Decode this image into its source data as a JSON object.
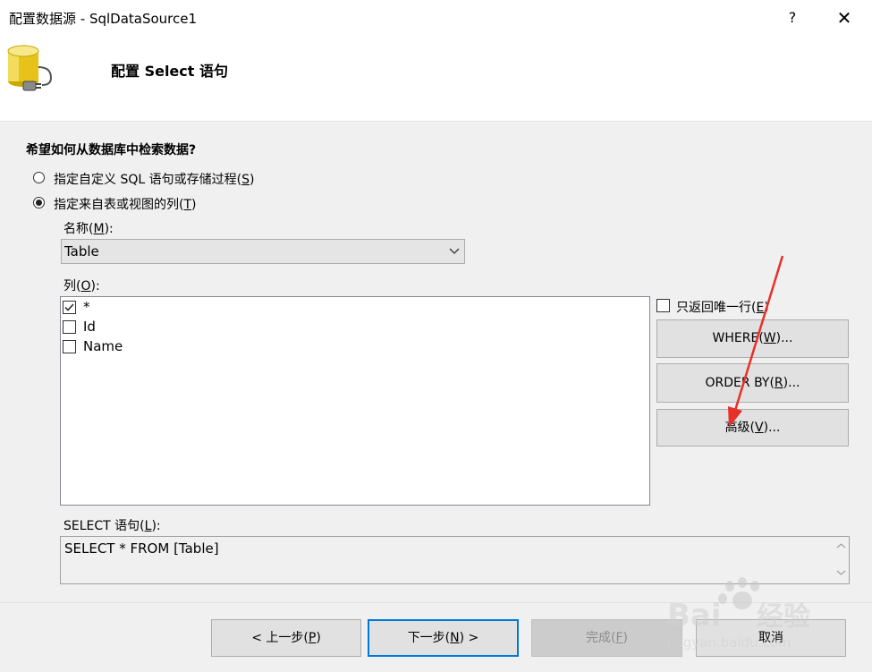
{
  "window": {
    "title": "配置数据源 - SqlDataSource1",
    "help": "?",
    "close": "✕"
  },
  "header": {
    "title": "配置 Select 语句"
  },
  "question": "希望如何从数据库中检索数据?",
  "options": {
    "custom_sql": {
      "text": "指定自定义 SQL 语句或存储过程(",
      "key": "S",
      "end": ")",
      "selected": false
    },
    "table_columns": {
      "text": "指定来自表或视图的列(",
      "key": "T",
      "end": ")",
      "selected": true
    }
  },
  "name_field": {
    "label": "名称(",
    "key": "M",
    "end": "):",
    "value": "Table"
  },
  "columns_field": {
    "label": "列(",
    "key": "O",
    "end": "):",
    "items": [
      {
        "label": "*",
        "checked": true
      },
      {
        "label": "Id",
        "checked": false
      },
      {
        "label": "Name",
        "checked": false
      }
    ]
  },
  "unique_rows": {
    "text": "只返回唯一行(",
    "key": "E",
    "end": ")",
    "checked": false
  },
  "buttons": {
    "where": {
      "text": "WHERE(",
      "key": "W",
      "end": ")..."
    },
    "order_by": {
      "text": "ORDER BY(",
      "key": "R",
      "end": ")..."
    },
    "advanced": {
      "text": "高级(",
      "key": "V",
      "end": ")..."
    }
  },
  "select_statement": {
    "label": "SELECT 语句(",
    "key": "L",
    "end": "):",
    "value": "SELECT * FROM [Table]"
  },
  "footer": {
    "previous": {
      "text": "< 上一步(",
      "key": "P",
      "end": ")"
    },
    "next": {
      "text": "下一步(",
      "key": "N",
      "end": ") >"
    },
    "finish": {
      "text": "完成(",
      "key": "F",
      "end": ")"
    },
    "cancel": {
      "text": "取消"
    }
  },
  "colors": {
    "accent": "#0078d7",
    "annotation_arrow": "#e8302a",
    "disabled_text": "#8c8c8c"
  },
  "annotation": "red arrow pointing to advanced-button",
  "watermark": "Baidu经验 jingyan.baidu.com"
}
